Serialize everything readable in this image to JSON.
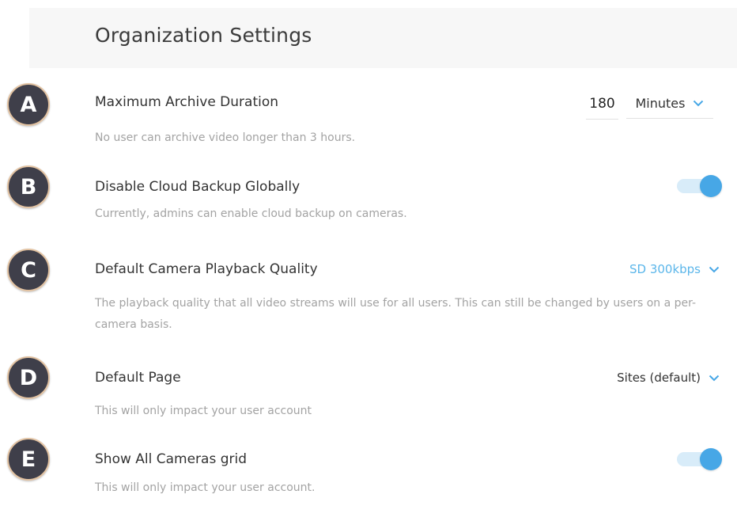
{
  "page": {
    "title": "Organization Settings"
  },
  "settings": [
    {
      "badge": "A",
      "label": "Maximum Archive Duration",
      "description": "No user can archive video longer than 3 hours.",
      "value": "180",
      "unit": "Minutes"
    },
    {
      "badge": "B",
      "label": "Disable Cloud Backup Globally",
      "description": "Currently, admins can enable cloud backup on cameras.",
      "toggle_on": true
    },
    {
      "badge": "C",
      "label": "Default Camera Playback Quality",
      "description": "The playback quality that all video streams will use for all users. This can still be changed by users on a per-camera basis.",
      "selected": "SD 300kbps"
    },
    {
      "badge": "D",
      "label": "Default Page",
      "description": "This will only impact your user account",
      "selected": "Sites (default)"
    },
    {
      "badge": "E",
      "label": "Show All Cameras grid",
      "description": "This will only impact your user account.",
      "toggle_on": true
    }
  ],
  "colors": {
    "accent": "#47a7e6",
    "accent_text": "#5bb6ea",
    "badge_bg": "#3f3f4a",
    "badge_border": "#e3c3a2"
  },
  "icons": {
    "dropdown": "chevron-down-icon"
  }
}
